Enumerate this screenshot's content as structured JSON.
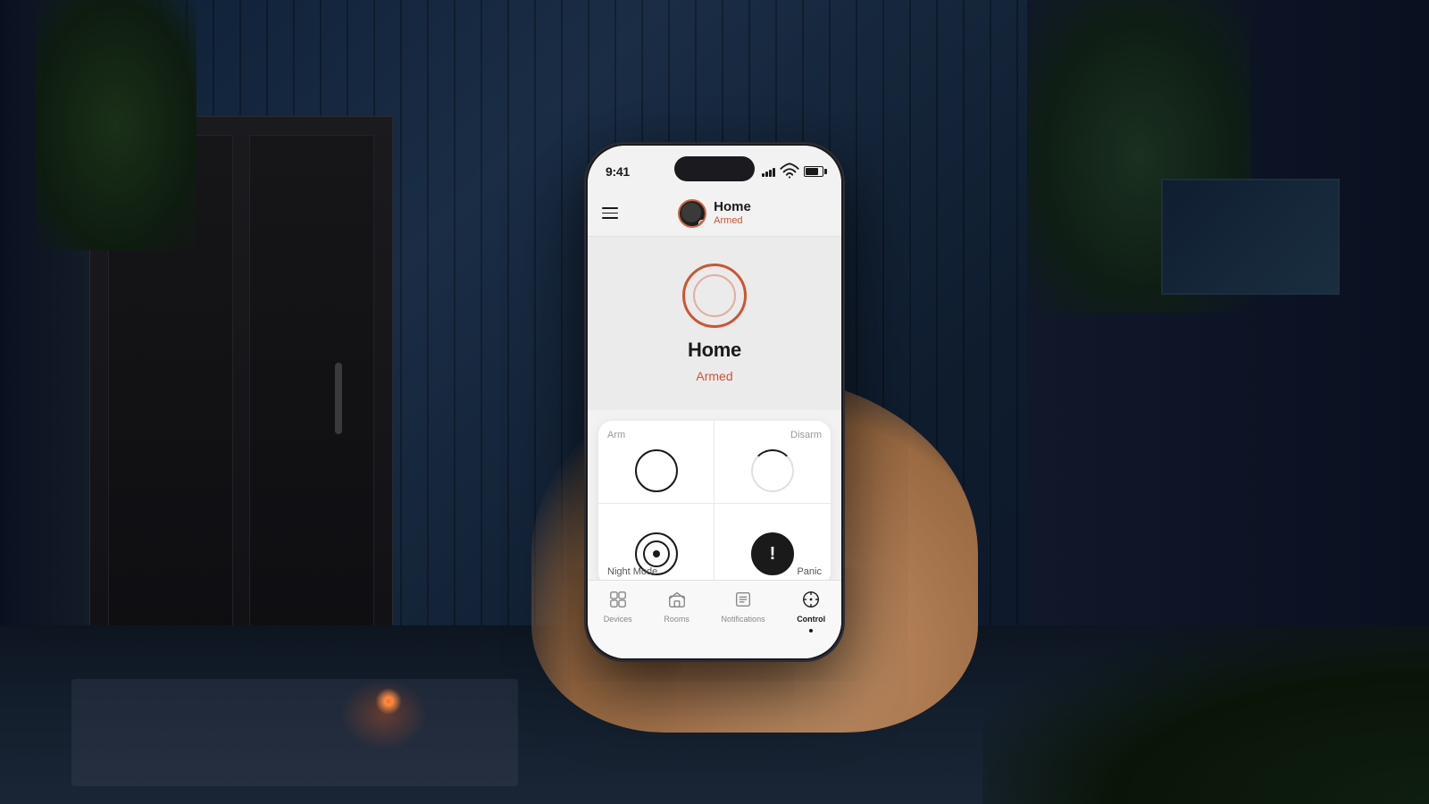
{
  "background": {
    "color": "#0a1628"
  },
  "phone": {
    "status_bar": {
      "time": "9:41",
      "signal": "visible",
      "wifi": "visible",
      "battery": "visible"
    },
    "header": {
      "menu_label": "menu",
      "location_name": "Home",
      "status": "Armed",
      "avatar_alt": "user avatar"
    },
    "alarm_status": {
      "title": "Home",
      "state": "Armed",
      "state_color": "#cc5533"
    },
    "controls": {
      "arm": {
        "label_top": "Arm",
        "icon": "circle"
      },
      "disarm": {
        "label_top": "Disarm",
        "icon": "loading"
      },
      "night_mode": {
        "label_bottom": "Night Mode",
        "icon": "target"
      },
      "panic": {
        "label_bottom": "Panic",
        "icon": "exclamation"
      }
    },
    "bottom_nav": {
      "items": [
        {
          "id": "devices",
          "label": "Devices",
          "active": false
        },
        {
          "id": "rooms",
          "label": "Rooms",
          "active": false
        },
        {
          "id": "notifications",
          "label": "Notifications",
          "active": false
        },
        {
          "id": "control",
          "label": "Control",
          "active": true
        }
      ]
    }
  }
}
